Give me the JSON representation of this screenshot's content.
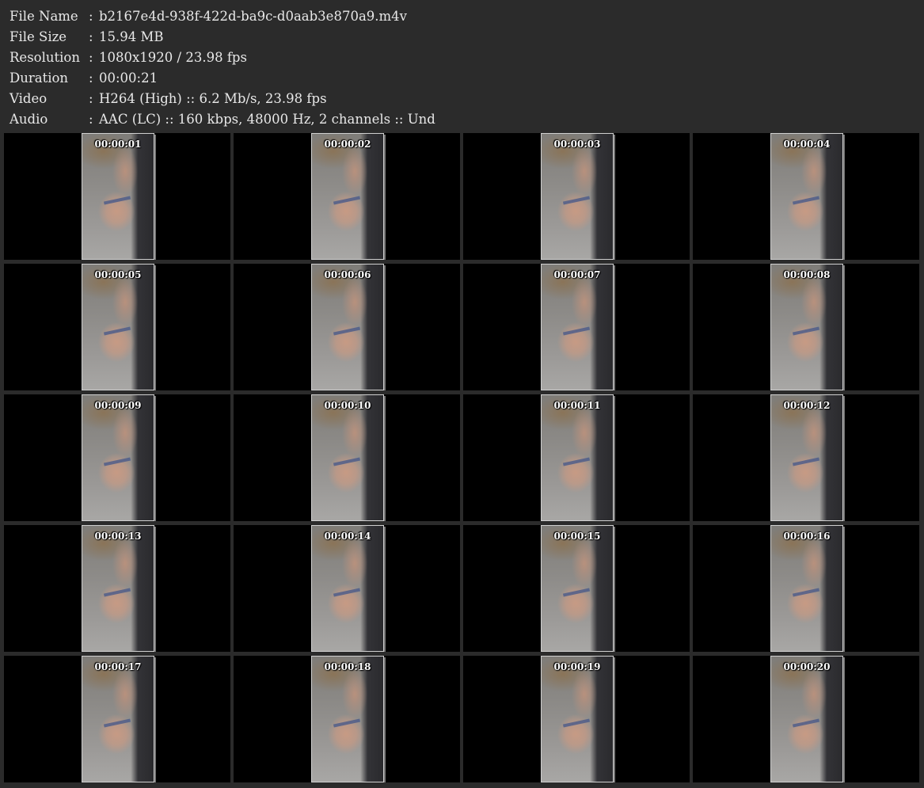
{
  "info": [
    {
      "label": "File Name",
      "sep": ":",
      "value": "b2167e4d-938f-422d-ba9c-d0aab3e870a9.m4v"
    },
    {
      "label": "File Size",
      "sep": ":",
      "value": "15.94 MB"
    },
    {
      "label": "Resolution",
      "sep": ":",
      "value": "1080x1920 / 23.98 fps"
    },
    {
      "label": "Duration",
      "sep": ":",
      "value": "00:00:21"
    },
    {
      "label": "Video",
      "sep": ":",
      "value": "H264 (High) :: 6.2 Mb/s, 23.98 fps"
    },
    {
      "label": "Audio",
      "sep": ":",
      "value": "AAC (LC) :: 160 kbps, 48000 Hz, 2 channels :: Und"
    }
  ],
  "thumbnails": [
    {
      "timestamp": "00:00:01"
    },
    {
      "timestamp": "00:00:02"
    },
    {
      "timestamp": "00:00:03"
    },
    {
      "timestamp": "00:00:04"
    },
    {
      "timestamp": "00:00:05"
    },
    {
      "timestamp": "00:00:06"
    },
    {
      "timestamp": "00:00:07"
    },
    {
      "timestamp": "00:00:08"
    },
    {
      "timestamp": "00:00:09"
    },
    {
      "timestamp": "00:00:10"
    },
    {
      "timestamp": "00:00:11"
    },
    {
      "timestamp": "00:00:12"
    },
    {
      "timestamp": "00:00:13"
    },
    {
      "timestamp": "00:00:14"
    },
    {
      "timestamp": "00:00:15"
    },
    {
      "timestamp": "00:00:16"
    },
    {
      "timestamp": "00:00:17"
    },
    {
      "timestamp": "00:00:18"
    },
    {
      "timestamp": "00:00:19"
    },
    {
      "timestamp": "00:00:20"
    }
  ],
  "colors": {
    "background": "#2b2b2b",
    "text": "#e8e8e8",
    "cell_background": "#000000"
  }
}
